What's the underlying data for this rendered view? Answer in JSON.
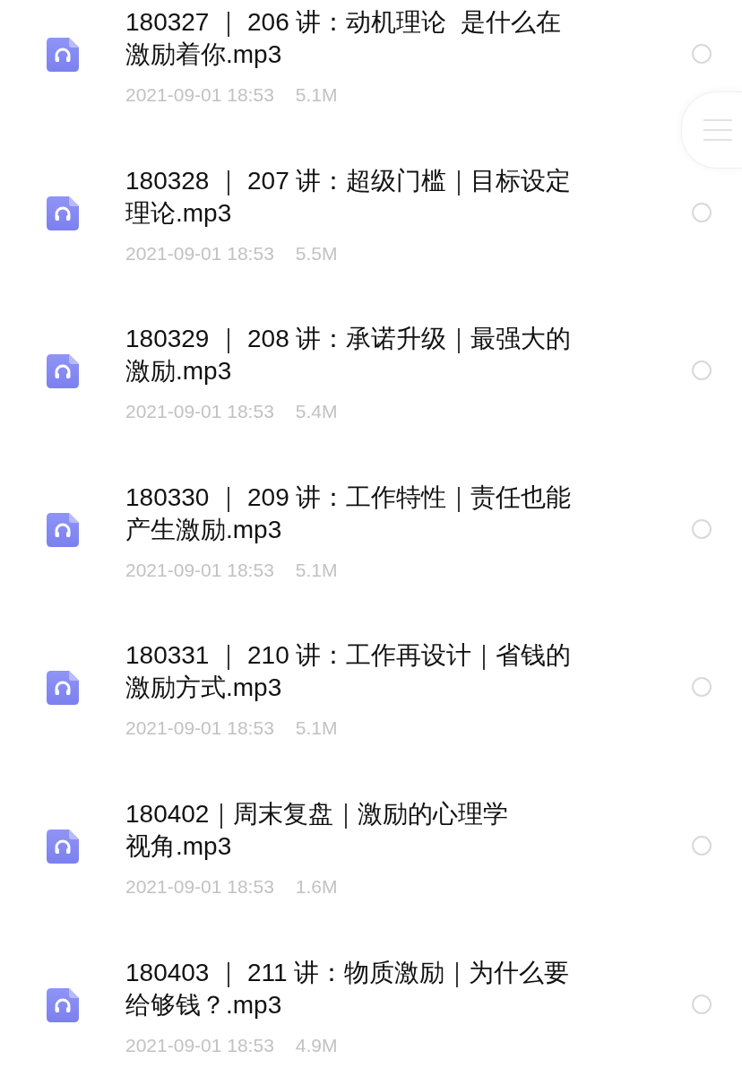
{
  "files": [
    {
      "title_lines": [
        "180327 ｜ 206 讲：动机理论  是什么在",
        "激励着你.mp3"
      ],
      "date": "2021-09-01 18:53",
      "size": "5.1M",
      "selected": false
    },
    {
      "title_lines": [
        "180328 ｜ 207 讲：超级门槛｜目标设定",
        "理论.mp3"
      ],
      "date": "2021-09-01 18:53",
      "size": "5.5M",
      "selected": false
    },
    {
      "title_lines": [
        "180329 ｜ 208 讲：承诺升级｜最强大的",
        "激励.mp3"
      ],
      "date": "2021-09-01 18:53",
      "size": "5.4M",
      "selected": false
    },
    {
      "title_lines": [
        "180330 ｜ 209 讲：工作特性｜责任也能",
        "产生激励.mp3"
      ],
      "date": "2021-09-01 18:53",
      "size": "5.1M",
      "selected": false
    },
    {
      "title_lines": [
        "180331 ｜ 210 讲：工作再设计｜省钱的",
        "激励方式.mp3"
      ],
      "date": "2021-09-01 18:53",
      "size": "5.1M",
      "selected": false
    },
    {
      "title_lines": [
        "180402｜周末复盘｜激励的心理学",
        "视角.mp3"
      ],
      "date": "2021-09-01 18:53",
      "size": "1.6M",
      "selected": false
    },
    {
      "title_lines": [
        "180403 ｜ 211 讲：物质激励｜为什么要",
        "给够钱？.mp3"
      ],
      "date": "2021-09-01 18:53",
      "size": "4.9M",
      "selected": false
    }
  ]
}
